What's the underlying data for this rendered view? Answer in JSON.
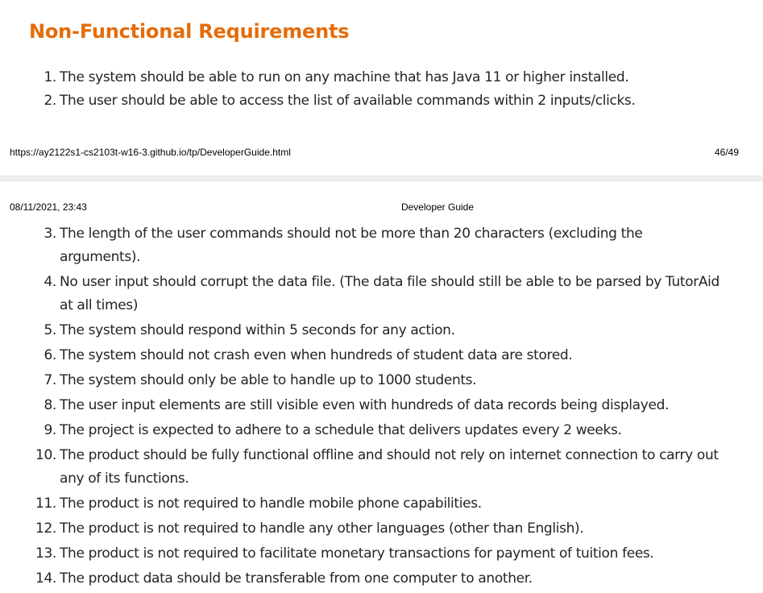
{
  "section": {
    "title": "Non-Functional Requirements"
  },
  "footer": {
    "url": "https://ay2122s1-cs2103t-w16-3.github.io/tp/DeveloperGuide.html",
    "page": "46/49"
  },
  "header": {
    "datetime": "08/11/2021, 23:43",
    "title": "Developer Guide"
  },
  "requirements": [
    {
      "num": "1.",
      "text": "The system should be able to run on any machine that has Java 11 or higher installed."
    },
    {
      "num": "2.",
      "text": "The user should be able to access the list of available commands within 2 inputs/clicks."
    },
    {
      "num": "3.",
      "text": "The length of the user commands should not be more than 20 characters (excluding the arguments)."
    },
    {
      "num": "4.",
      "text": "No user input should corrupt the data file. (The data file should still be able to be parsed by TutorAid at all times)"
    },
    {
      "num": "5.",
      "text": "The system should respond within 5 seconds for any action."
    },
    {
      "num": "6.",
      "text": "The system should not crash even when hundreds of student data are stored."
    },
    {
      "num": "7.",
      "text": "The system should only be able to handle up to 1000 students."
    },
    {
      "num": "8.",
      "text": "The user input elements are still visible even with hundreds of data records being displayed."
    },
    {
      "num": "9.",
      "text": "The project is expected to adhere to a schedule that delivers updates every 2 weeks."
    },
    {
      "num": "10.",
      "text": "The product should be fully functional offline and should not rely on internet connection to carry out any of its functions."
    },
    {
      "num": "11.",
      "text": "The product is not required to handle mobile phone capabilities."
    },
    {
      "num": "12.",
      "text": "The product is not required to handle any other languages (other than English)."
    },
    {
      "num": "13.",
      "text": "The product is not required to facilitate monetary transactions for payment of tuition fees."
    },
    {
      "num": "14.",
      "text": "The product data should be transferable from one computer to another."
    }
  ]
}
